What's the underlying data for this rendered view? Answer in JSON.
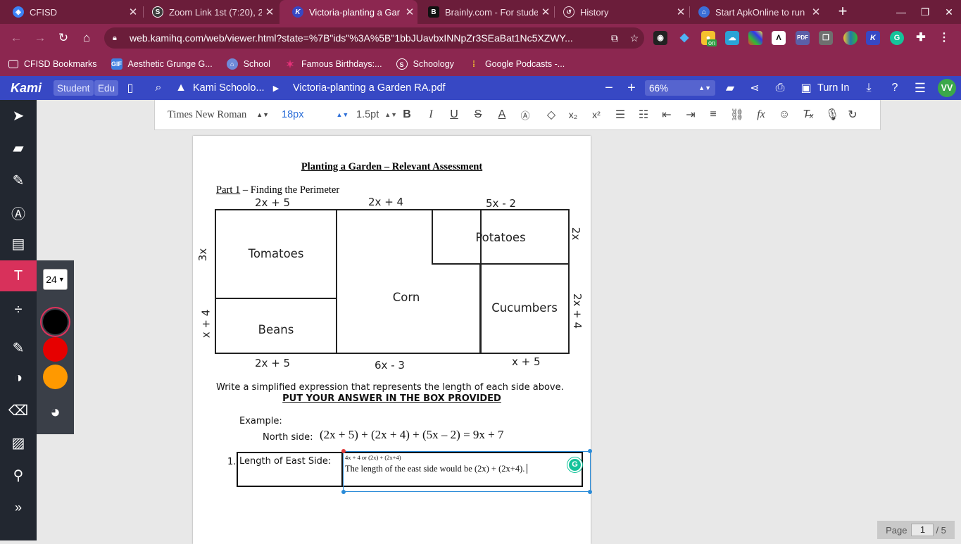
{
  "browser": {
    "tabs": [
      {
        "title": "CFISD",
        "favicon": "cfisd-icon",
        "color": "#3b82f6"
      },
      {
        "title": "Zoom Link 1st (7:20), 2",
        "favicon": "schoology-s-icon",
        "color": "#3a3a3a"
      },
      {
        "title": "Victoria-planting a Gar",
        "favicon": "kami-k-icon",
        "color": "#3748c4"
      },
      {
        "title": "Brainly.com - For stude",
        "favicon": "brainly-b-icon",
        "color": "#111111"
      },
      {
        "title": "History",
        "favicon": "history-icon",
        "color": "#6b1d3a"
      },
      {
        "title": "Start ApkOnline to run",
        "favicon": "apkonline-icon",
        "color": "#3b6fd8"
      }
    ],
    "url": "web.kamihq.com/web/viewer.html?state=%7B\"ids\"%3A%5B\"1bbJUavbxINNpZr3SEaBat1Nc5XZWY...",
    "bookmarks": [
      {
        "label": "CFISD Bookmarks",
        "icon": "folder-icon"
      },
      {
        "label": "Aesthetic Grunge G...",
        "icon": "gif-icon"
      },
      {
        "label": "School",
        "icon": "school-icon"
      },
      {
        "label": "Famous Birthdays:...",
        "icon": "star-icon"
      },
      {
        "label": "Schoology",
        "icon": "schoology-icon"
      },
      {
        "label": "Google Podcasts -...",
        "icon": "podcasts-icon"
      }
    ],
    "extension_badge": "on"
  },
  "kami": {
    "logo": "Kami",
    "role_student": "Student",
    "role_edu": "Edu",
    "drive_label": "Kami Schoolo...",
    "file_name": "Victoria-planting a Garden RA.pdf",
    "zoom": "66%",
    "turn_in": "Turn In",
    "avatar": "VV",
    "font_family": "Times New Roman",
    "font_size": "18px",
    "line_spacing": "1.5pt",
    "flyout_size": "24",
    "swatches": [
      "#000000",
      "#e60000",
      "#ff9900"
    ],
    "page_current": "1",
    "page_label": "Page",
    "page_total": "/ 5"
  },
  "document": {
    "title": "Planting a Garden – Relevant Assessment",
    "part_label": "Part 1",
    "part_rest": " – Finding the Perimeter",
    "top_labels": [
      "2x + 5",
      "2x + 4",
      "5x - 2"
    ],
    "bottom_labels": [
      "2x + 5",
      "6x - 3",
      "x + 5"
    ],
    "left_labels": [
      "3x",
      "x + 4"
    ],
    "right_labels": [
      "2x",
      "2x + 4"
    ],
    "regions": {
      "tomatoes": "Tomatoes",
      "beans": "Beans",
      "corn": "Corn",
      "potatoes": "Potatoes",
      "cucumbers": "Cucumbers"
    },
    "instruction": "Write a simplified expression that represents the length of each side above.",
    "instruction_bold": "PUT YOUR ANSWER IN THE BOX PROVIDED",
    "example_label": "Example:",
    "north_label": "North side:",
    "north_expr": "(2x + 5) + (2x + 4) + (5x – 2) = 9x + 7",
    "q1_number": "1.",
    "q1_label": "Length of East Side:",
    "answer_small": "4x + 4 or (2x) + (2x+4)",
    "answer_text": "The length of the east side would be (2x) + (2x+4)."
  }
}
